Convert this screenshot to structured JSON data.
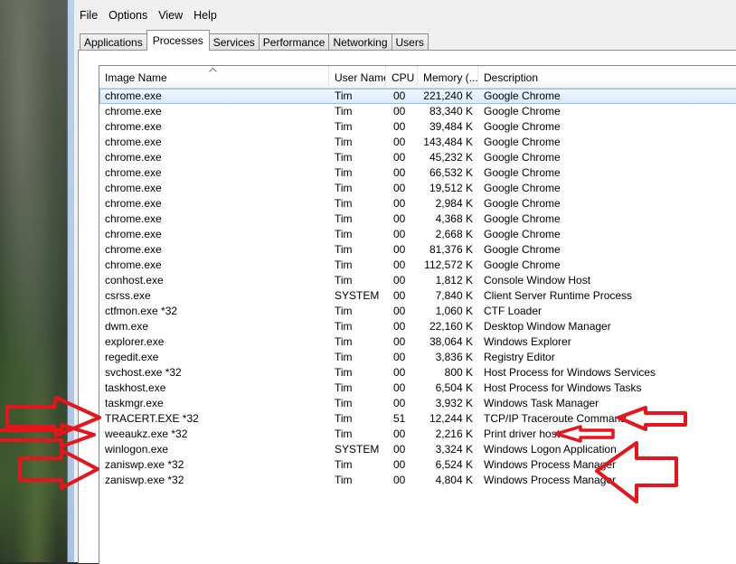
{
  "menu": [
    "File",
    "Options",
    "View",
    "Help"
  ],
  "tabs": [
    {
      "label": "Applications",
      "active": false
    },
    {
      "label": "Processes",
      "active": true
    },
    {
      "label": "Services",
      "active": false
    },
    {
      "label": "Performance",
      "active": false
    },
    {
      "label": "Networking",
      "active": false
    },
    {
      "label": "Users",
      "active": false
    }
  ],
  "columns": {
    "image_name": "Image Name",
    "user_name": "User Name",
    "cpu": "CPU",
    "memory": "Memory (...",
    "description": "Description"
  },
  "sort_indicator": "^",
  "processes": [
    {
      "image": "chrome.exe",
      "user": "Tim",
      "cpu": "00",
      "memory": "221,240 K",
      "description": "Google Chrome",
      "selected": true
    },
    {
      "image": "chrome.exe",
      "user": "Tim",
      "cpu": "00",
      "memory": "83,340 K",
      "description": "Google Chrome"
    },
    {
      "image": "chrome.exe",
      "user": "Tim",
      "cpu": "00",
      "memory": "39,484 K",
      "description": "Google Chrome"
    },
    {
      "image": "chrome.exe",
      "user": "Tim",
      "cpu": "00",
      "memory": "143,484 K",
      "description": "Google Chrome"
    },
    {
      "image": "chrome.exe",
      "user": "Tim",
      "cpu": "00",
      "memory": "45,232 K",
      "description": "Google Chrome"
    },
    {
      "image": "chrome.exe",
      "user": "Tim",
      "cpu": "00",
      "memory": "66,532 K",
      "description": "Google Chrome"
    },
    {
      "image": "chrome.exe",
      "user": "Tim",
      "cpu": "00",
      "memory": "19,512 K",
      "description": "Google Chrome"
    },
    {
      "image": "chrome.exe",
      "user": "Tim",
      "cpu": "00",
      "memory": "2,984 K",
      "description": "Google Chrome"
    },
    {
      "image": "chrome.exe",
      "user": "Tim",
      "cpu": "00",
      "memory": "4,368 K",
      "description": "Google Chrome"
    },
    {
      "image": "chrome.exe",
      "user": "Tim",
      "cpu": "00",
      "memory": "2,668 K",
      "description": "Google Chrome"
    },
    {
      "image": "chrome.exe",
      "user": "Tim",
      "cpu": "00",
      "memory": "81,376 K",
      "description": "Google Chrome"
    },
    {
      "image": "chrome.exe",
      "user": "Tim",
      "cpu": "00",
      "memory": "112,572 K",
      "description": "Google Chrome"
    },
    {
      "image": "conhost.exe",
      "user": "Tim",
      "cpu": "00",
      "memory": "1,812 K",
      "description": "Console Window Host"
    },
    {
      "image": "csrss.exe",
      "user": "SYSTEM",
      "cpu": "00",
      "memory": "7,840 K",
      "description": "Client Server Runtime Process"
    },
    {
      "image": "ctfmon.exe *32",
      "user": "Tim",
      "cpu": "00",
      "memory": "1,060 K",
      "description": "CTF Loader"
    },
    {
      "image": "dwm.exe",
      "user": "Tim",
      "cpu": "00",
      "memory": "22,160 K",
      "description": "Desktop Window Manager"
    },
    {
      "image": "explorer.exe",
      "user": "Tim",
      "cpu": "00",
      "memory": "38,064 K",
      "description": "Windows Explorer"
    },
    {
      "image": "regedit.exe",
      "user": "Tim",
      "cpu": "00",
      "memory": "3,836 K",
      "description": "Registry Editor"
    },
    {
      "image": "svchost.exe *32",
      "user": "Tim",
      "cpu": "00",
      "memory": "800 K",
      "description": "Host Process for Windows Services"
    },
    {
      "image": "taskhost.exe",
      "user": "Tim",
      "cpu": "00",
      "memory": "6,504 K",
      "description": "Host Process for Windows Tasks"
    },
    {
      "image": "taskmgr.exe",
      "user": "Tim",
      "cpu": "00",
      "memory": "3,932 K",
      "description": "Windows Task Manager"
    },
    {
      "image": "TRACERT.EXE *32",
      "user": "Tim",
      "cpu": "51",
      "memory": "12,244 K",
      "description": "TCP/IP Traceroute Command"
    },
    {
      "image": "weeaukz.exe *32",
      "user": "Tim",
      "cpu": "00",
      "memory": "2,216 K",
      "description": "Print driver host"
    },
    {
      "image": "winlogon.exe",
      "user": "SYSTEM",
      "cpu": "00",
      "memory": "3,324 K",
      "description": "Windows Logon Application"
    },
    {
      "image": "zaniswp.exe *32",
      "user": "Tim",
      "cpu": "00",
      "memory": "6,524 K",
      "description": "Windows Process Manager"
    },
    {
      "image": "zaniswp.exe *32",
      "user": "Tim",
      "cpu": "00",
      "memory": "4,804 K",
      "description": "Windows Process Manager"
    }
  ],
  "colors": {
    "annotation_arrow": "#e8141c",
    "selection_border": "#8fbce9",
    "window_frame": "#b9d1ea"
  }
}
